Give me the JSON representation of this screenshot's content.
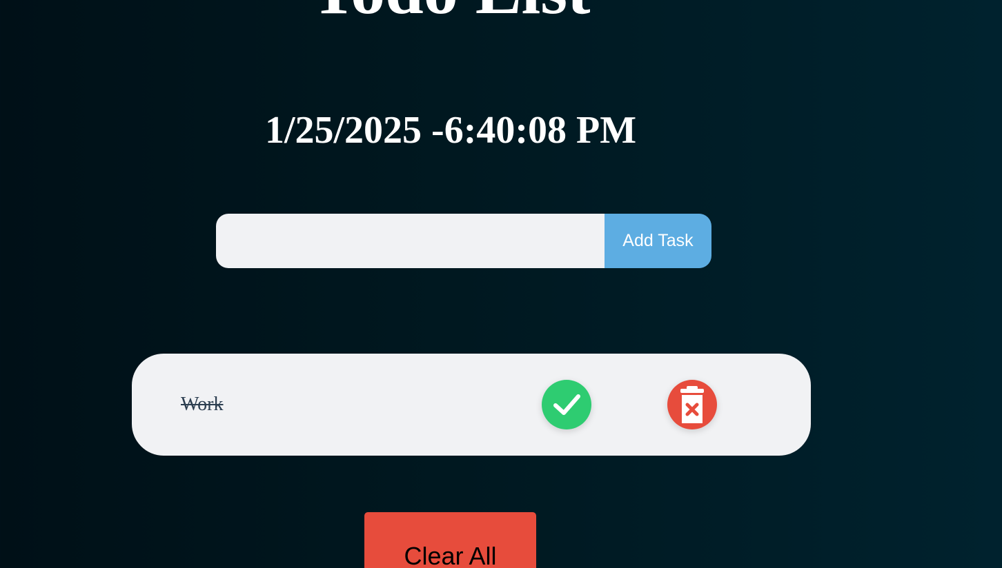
{
  "header": {
    "title": "Todo List",
    "datetime": "1/25/2025 -6:40:08 PM"
  },
  "form": {
    "input_value": "",
    "input_placeholder": "",
    "add_button_label": "Add Task"
  },
  "tasks": [
    {
      "text": "Work",
      "completed": true,
      "check_icon": "check-icon",
      "delete_icon": "trash-icon"
    }
  ],
  "footer": {
    "clear_button_label": "Clear All"
  },
  "colors": {
    "background": "#001820",
    "accent_blue": "#5dade2",
    "success_green": "#2ecc71",
    "danger_red": "#e74c3c",
    "card": "#f1f2f4",
    "task_text": "#2c3e50"
  }
}
